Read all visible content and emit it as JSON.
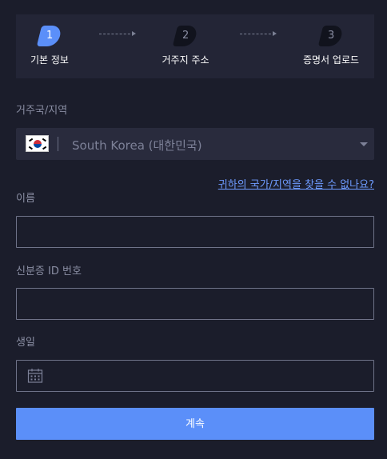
{
  "steps": [
    {
      "number": "1",
      "label": "기본 정보",
      "active": true
    },
    {
      "number": "2",
      "label": "거주지 주소",
      "active": false
    },
    {
      "number": "3",
      "label": "증명서 업로드",
      "active": false
    }
  ],
  "form": {
    "country_label": "거주국/지역",
    "country_value": "South Korea (대한민국)",
    "country_flag": "south-korea-flag",
    "help_link": "귀하의 국가/지역을 찾을 수 없나요?",
    "name_label": "이름",
    "name_value": "",
    "id_label": "신분증 ID 번호",
    "id_value": "",
    "birth_label": "생일",
    "birth_value": "",
    "submit_label": "계속"
  },
  "colors": {
    "background": "#1b1d2b",
    "panel": "#232536",
    "accent": "#5b8ff9",
    "link": "#6e9bff"
  }
}
